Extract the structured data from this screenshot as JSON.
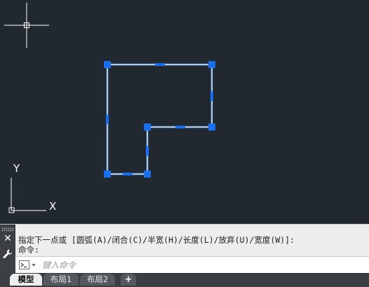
{
  "viewport": {
    "ucs_y_label": "Y",
    "ucs_x_label": "X"
  },
  "command": {
    "history": [
      "指定下一点或 [圆弧(A)/闭合(C)/半宽(H)/长度(L)/放弃(U)/宽度(W)]:",
      "命令:"
    ],
    "input_placeholder": "键入命令"
  },
  "tabs": {
    "model": "模型",
    "layout1": "布局1",
    "layout2": "布局2",
    "add": "+"
  },
  "icons": {
    "close": "close-icon",
    "settings": "wrench-icon",
    "prompt": "command-prompt-icon"
  },
  "colors": {
    "canvas_background": "#212830",
    "polyline_selected": "#ffffff",
    "grip": "#1a6ef0",
    "ucs_icon": "#ffffff"
  }
}
